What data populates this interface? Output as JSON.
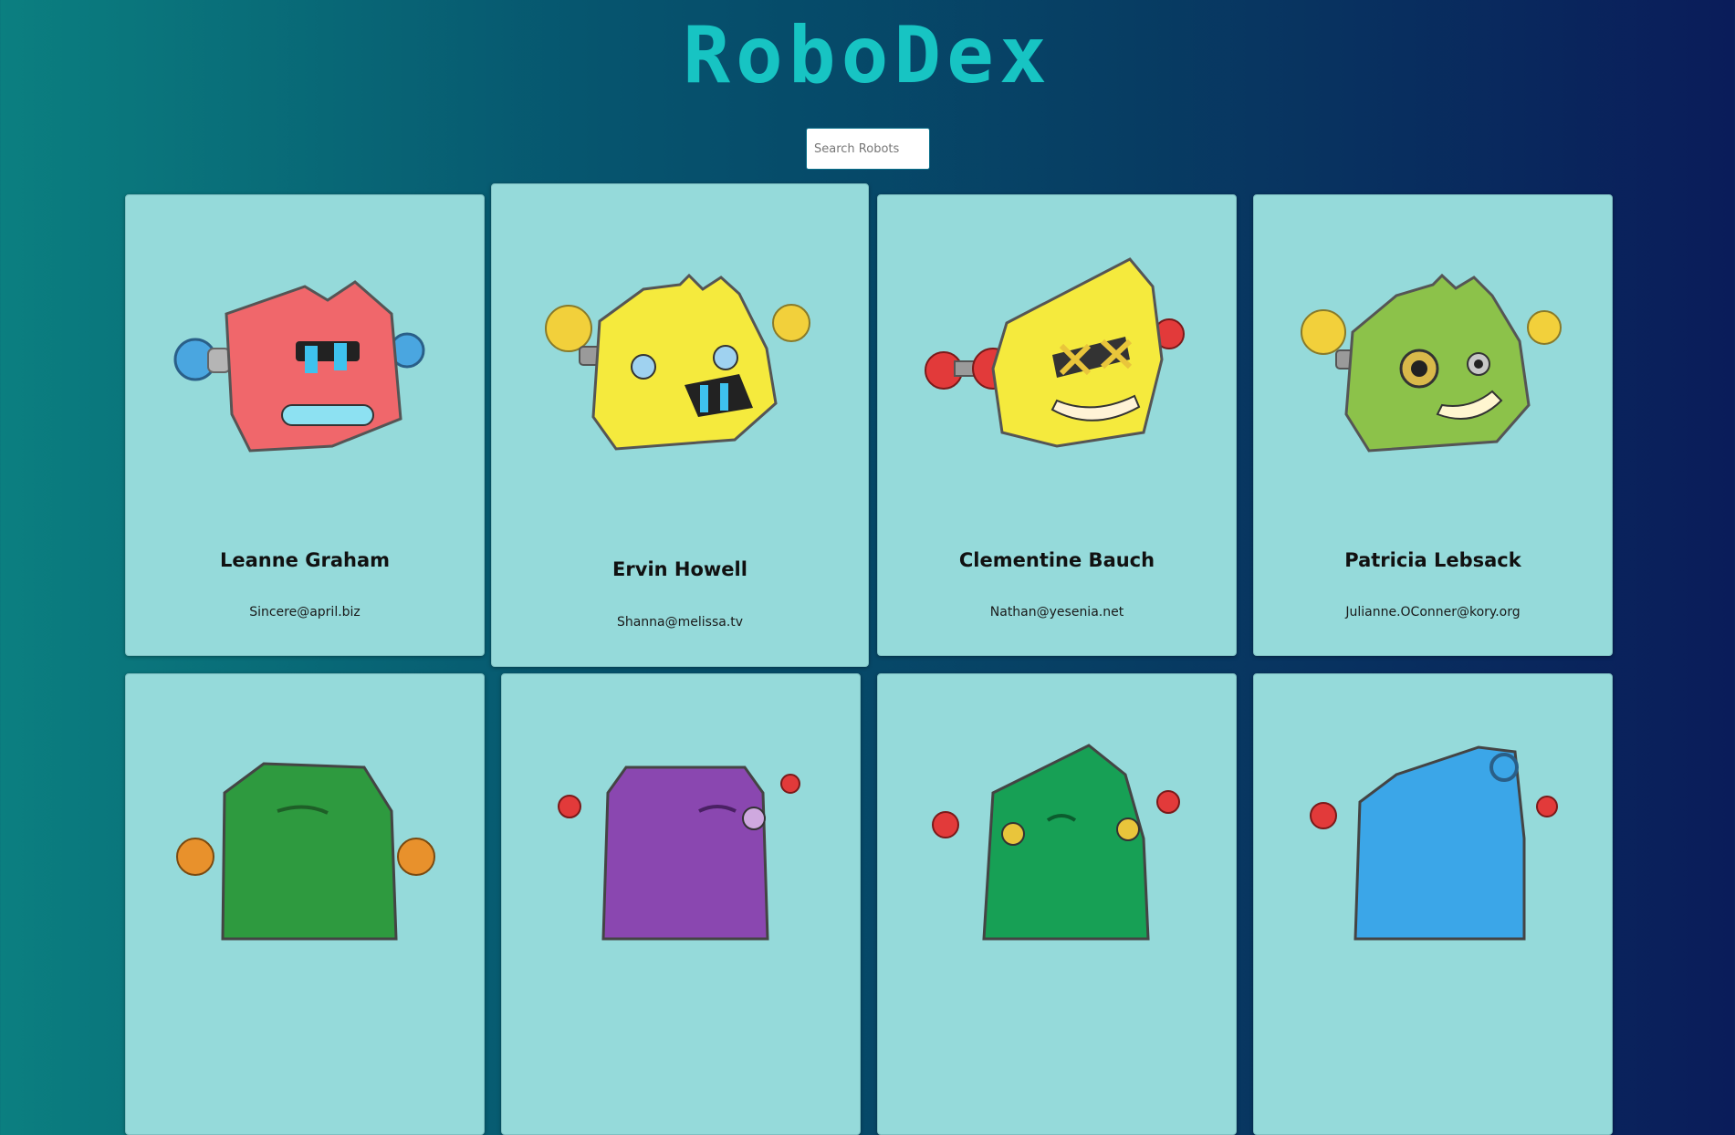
{
  "app": {
    "title": "RoboDex"
  },
  "search": {
    "placeholder": "Search Robots",
    "value": ""
  },
  "robots": [
    {
      "name": "Leanne Graham",
      "email": "Sincere@april.biz",
      "color": "#f0676b"
    },
    {
      "name": "Ervin Howell",
      "email": "Shanna@melissa.tv",
      "color": "#f5ea3d"
    },
    {
      "name": "Clementine Bauch",
      "email": "Nathan@yesenia.net",
      "color": "#f5ea3d"
    },
    {
      "name": "Patricia Lebsack",
      "email": "Julianne.OConner@kory.org",
      "color": "#8cc24a"
    },
    {
      "name": "",
      "email": "",
      "color": "#2e9a3f"
    },
    {
      "name": "",
      "email": "",
      "color": "#8a47b0"
    },
    {
      "name": "",
      "email": "",
      "color": "#17a055"
    },
    {
      "name": "",
      "email": "",
      "color": "#3ba6e8"
    }
  ]
}
